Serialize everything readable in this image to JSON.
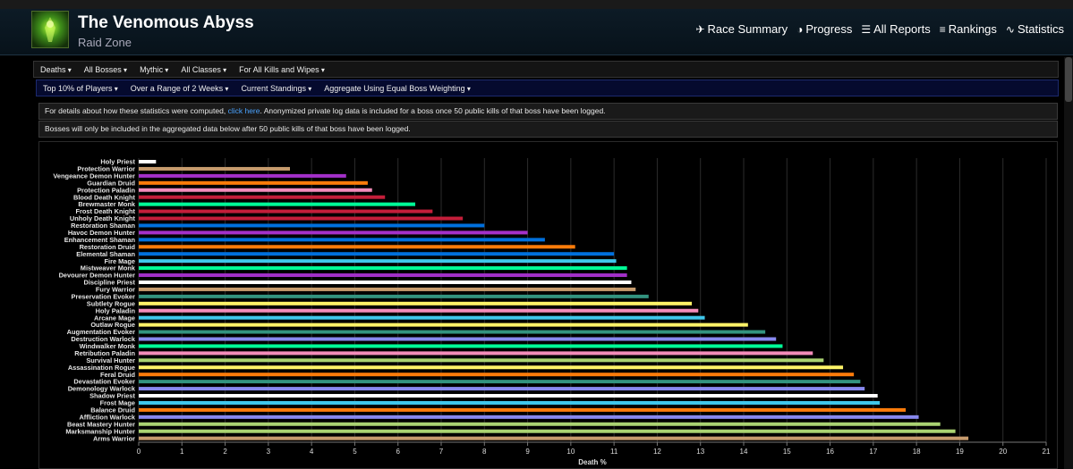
{
  "zone": {
    "title": "The Venomous Abyss",
    "subtitle": "Raid Zone"
  },
  "nav": [
    {
      "icon": "runner-icon",
      "glyph": "✈",
      "label": "Race Summary"
    },
    {
      "icon": "progress-icon",
      "glyph": "◑",
      "label": "Progress"
    },
    {
      "icon": "list-icon",
      "glyph": "☰",
      "label": "All Reports"
    },
    {
      "icon": "rankings-icon",
      "glyph": "≡",
      "label": "Rankings"
    },
    {
      "icon": "statistics-icon",
      "glyph": "∿",
      "label": "Statistics"
    }
  ],
  "filters_row1": [
    "Deaths",
    "All Bosses",
    "Mythic",
    "All Classes",
    "For All Kills and Wipes"
  ],
  "filters_row2": [
    "Top 10% of Players",
    "Over a Range of 2 Weeks",
    "Current Standings",
    "Aggregate Using Equal Boss Weighting"
  ],
  "info1": {
    "before": "For details about how these statistics were computed,",
    "link": "click here",
    "after": ". Anonymized private log data is included for a boss once 50 public kills of that boss have been logged."
  },
  "info2": "Bosses will only be included in the aggregated data below after 50 public kills of that boss have been logged.",
  "chart_data": {
    "type": "bar",
    "orientation": "horizontal",
    "xlabel": "Death %",
    "xlim": [
      0,
      21
    ],
    "xticks": [
      0,
      1,
      2,
      3,
      4,
      5,
      6,
      7,
      8,
      9,
      10,
      11,
      12,
      13,
      14,
      15,
      16,
      17,
      18,
      19,
      20,
      21
    ],
    "grid": true,
    "categories": [
      "Holy Priest",
      "Protection Warrior",
      "Vengeance Demon Hunter",
      "Guardian Druid",
      "Protection Paladin",
      "Blood Death Knight",
      "Brewmaster Monk",
      "Frost Death Knight",
      "Unholy Death Knight",
      "Restoration Shaman",
      "Havoc Demon Hunter",
      "Enhancement Shaman",
      "Restoration Druid",
      "Elemental Shaman",
      "Fire Mage",
      "Mistweaver Monk",
      "Devourer Demon Hunter",
      "Discipline Priest",
      "Fury Warrior",
      "Preservation Evoker",
      "Subtlety Rogue",
      "Holy Paladin",
      "Arcane Mage",
      "Outlaw Rogue",
      "Augmentation Evoker",
      "Destruction Warlock",
      "Windwalker Monk",
      "Retribution Paladin",
      "Survival Hunter",
      "Assassination Rogue",
      "Feral Druid",
      "Devastation Evoker",
      "Demonology Warlock",
      "Shadow Priest",
      "Frost Mage",
      "Balance Druid",
      "Affliction Warlock",
      "Beast Mastery Hunter",
      "Marksmanship Hunter",
      "Arms Warrior"
    ],
    "values": [
      0.4,
      3.5,
      4.8,
      5.3,
      5.4,
      5.7,
      6.4,
      6.8,
      7.5,
      8.0,
      9.0,
      9.4,
      10.1,
      11.0,
      11.05,
      11.3,
      11.3,
      11.4,
      11.5,
      11.8,
      12.8,
      12.95,
      13.1,
      14.1,
      14.5,
      14.75,
      14.9,
      15.6,
      15.85,
      16.3,
      16.55,
      16.7,
      16.8,
      17.1,
      17.15,
      17.75,
      18.05,
      18.55,
      18.9,
      19.2
    ],
    "colors": [
      "#FFFFFF",
      "#C69B6D",
      "#A330C9",
      "#FF7C0A",
      "#F48CBA",
      "#C41E3A",
      "#00FF98",
      "#C41E3A",
      "#C41E3A",
      "#0070DD",
      "#A330C9",
      "#0070DD",
      "#FF7C0A",
      "#0070DD",
      "#3FC7EB",
      "#00FF98",
      "#A330C9",
      "#FFFFFF",
      "#C69B6D",
      "#33937F",
      "#FFF468",
      "#F48CBA",
      "#3FC7EB",
      "#FFF468",
      "#33937F",
      "#8788EE",
      "#00FF98",
      "#F48CBA",
      "#AAD372",
      "#FFF468",
      "#FF7C0A",
      "#33937F",
      "#8788EE",
      "#FFFFFF",
      "#3FC7EB",
      "#FF7C0A",
      "#8788EE",
      "#AAD372",
      "#AAD372",
      "#C69B6D"
    ]
  }
}
